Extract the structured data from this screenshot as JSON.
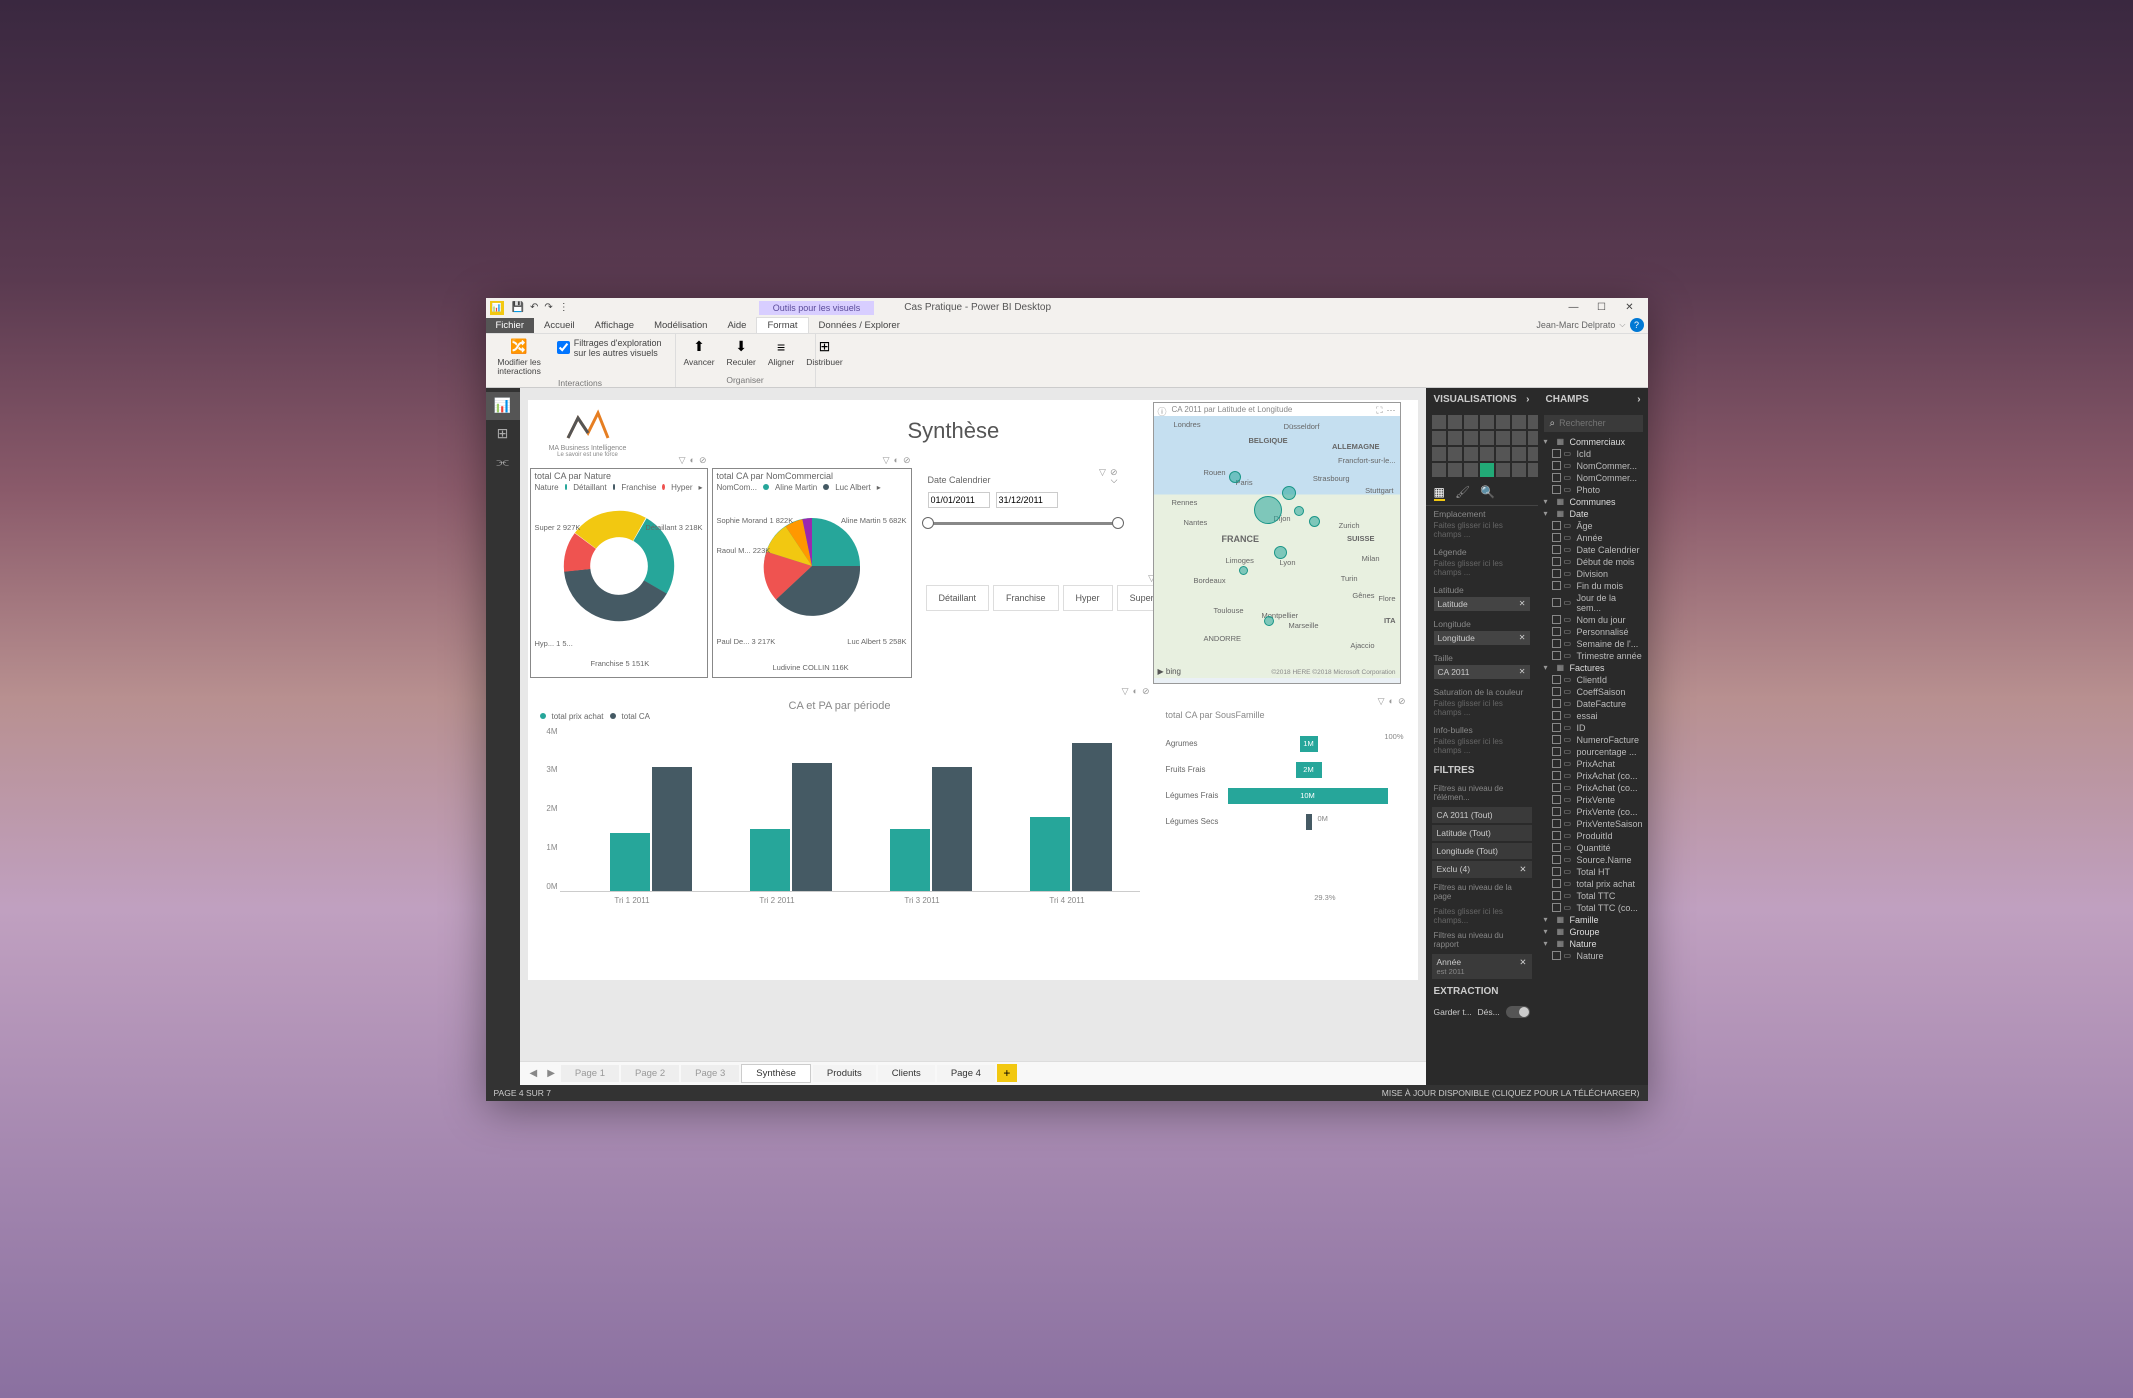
{
  "titlebar": {
    "tool_tab": "Outils pour les visuels",
    "app_title": "Cas Pratique - Power BI Desktop",
    "user": "Jean-Marc Delprato"
  },
  "ribbon_tabs": [
    "Fichier",
    "Accueil",
    "Affichage",
    "Modélisation",
    "Aide",
    "Format",
    "Données / Explorer"
  ],
  "ribbon": {
    "interactions_checkbox": "Filtrages d'exploration sur les autres visuels",
    "btn_modify": "Modifier les\ninteractions",
    "group_interactions": "Interactions",
    "btn_forward": "Avancer",
    "btn_backward": "Reculer",
    "btn_align": "Aligner",
    "btn_distribute": "Distribuer",
    "group_organize": "Organiser"
  },
  "viz_panel": {
    "title": "VISUALISATIONS",
    "well_emplacement": "Emplacement",
    "well_drag": "Faites glisser ici les champs ...",
    "well_legende": "Légende",
    "well_latitude": "Latitude",
    "well_longitude": "Longitude",
    "well_taille": "Taille",
    "well_ca2011": "CA 2011",
    "well_saturation": "Saturation de la couleur",
    "well_infobulle": "Info-bulles",
    "filters_title": "FILTRES",
    "filter_element": "Filtres au niveau de l'élémen...",
    "filter_ca": "CA 2011  (Tout)",
    "filter_lat": "Latitude  (Tout)",
    "filter_lon": "Longitude  (Tout)",
    "filter_exclu": "Exclu (4)",
    "filter_page": "Filtres au niveau de la page",
    "filter_drag": "Faites glisser ici les champs...",
    "filter_report": "Filtres au niveau du rapport",
    "filter_annee": "Année",
    "filter_annee_val": "est 2011",
    "extraction_title": "EXTRACTION",
    "extraction_keep": "Garder t...",
    "extraction_off": "Dés..."
  },
  "champs_panel": {
    "title": "CHAMPS",
    "search_ph": "Rechercher",
    "tables": [
      {
        "name": "Commerciaux",
        "cols": [
          "IcId",
          "NomCommer...",
          "NomCommer...",
          "Photo"
        ]
      },
      {
        "name": "Communes",
        "cols": []
      },
      {
        "name": "Date",
        "cols": [
          "Âge",
          "Année",
          "Date Calendrier",
          "Début de mois",
          "Division",
          "Fin du mois",
          "Jour de la sem...",
          "Nom du jour",
          "Personnalisé",
          "Semaine de l'...",
          "Trimestre année"
        ]
      },
      {
        "name": "Factures",
        "cols": [
          "ClientId",
          "CoeffSaison",
          "DateFacture",
          "essai",
          "ID",
          "NumeroFacture",
          "pourcentage ...",
          "PrixAchat",
          "PrixAchat (co...",
          "PrixAchat (co...",
          "PrixVente",
          "PrixVente (co...",
          "PrixVenteSaison",
          "ProduitId",
          "Quantité",
          "Source.Name",
          "Total HT",
          "total prix achat",
          "Total TTC",
          "Total TTC (co..."
        ]
      },
      {
        "name": "Famille",
        "cols": []
      },
      {
        "name": "Groupe",
        "cols": []
      },
      {
        "name": "Nature",
        "cols": [
          "Nature"
        ]
      }
    ]
  },
  "pages": {
    "list": [
      "Page 1",
      "Page 2",
      "Page 3",
      "Synthèse",
      "Produits",
      "Clients",
      "Page 4"
    ],
    "active": "Synthèse"
  },
  "status": {
    "left": "PAGE 4 SUR 7",
    "right": "MISE À JOUR DISPONIBLE (CLIQUEZ POUR LA TÉLÉCHARGER)"
  },
  "report": {
    "logo_text": "MA Business Intelligence",
    "logo_sub": "Le savoir est une force",
    "synth_title": "Synthèse",
    "donut": {
      "title": "total CA par Nature",
      "legend_label": "Nature",
      "items": [
        "Détaillant",
        "Franchise",
        "Hyper"
      ],
      "labels": {
        "super": "Super 2 927K",
        "detaillant": "Détaillant\n3 218K",
        "hyper": "Hyp...\n1 5...",
        "franchise": "Franchise\n5 151K"
      }
    },
    "pie": {
      "title": "total CA par NomCommercial",
      "legend_label": "NomCom...",
      "legend": [
        "Aline Martin",
        "Luc Albert"
      ],
      "labels": {
        "sophie": "Sophie Morand\n1 822K",
        "aline": "Aline Martin\n5 682K",
        "raoul": "Raoul M...\n223K",
        "paul": "Paul De...\n3 217K",
        "ludivine": "Ludivine COLLIN\n116K",
        "luc": "Luc Albert\n5 258K"
      }
    },
    "date_slicer": {
      "label": "Date Calendrier",
      "from": "01/01/2011",
      "to": "31/12/2011"
    },
    "buttons": [
      "Détaillant",
      "Franchise",
      "Hyper",
      "Super"
    ],
    "map": {
      "title": "CA 2011 par Latitude et Longitude",
      "cities": [
        "Londres",
        "Düsseldorf",
        "ALLEMAGNE",
        "BELGIQUE",
        "Francfort-sur-le...",
        "Rouen",
        "Paris",
        "Strasbourg",
        "Stuttgart",
        "Rennes",
        "Nantes",
        "Dijon",
        "Zurich",
        "FRANCE",
        "SUISSE",
        "Limoges",
        "Lyon",
        "Milan",
        "Bordeaux",
        "Turin",
        "Gênes",
        "Flore",
        "Toulouse",
        "Montpellier",
        "Marseille",
        "ITA",
        "ANDORRE",
        "Ajaccio"
      ],
      "bing": "bing",
      "copyright": "©2018 HERE ©2018 Microsoft Corporation"
    },
    "bar_chart": {
      "title": "CA et PA par période",
      "legend": [
        "total prix achat",
        "total CA"
      ],
      "y_ticks": [
        "4M",
        "3M",
        "2M",
        "1M",
        "0M"
      ],
      "categories": [
        "Tri 1 2011",
        "Tri 2 2011",
        "Tri 3 2011",
        "Tri 4 2011"
      ]
    },
    "hbar_chart": {
      "title": "total CA par SousFamille",
      "pct100": "100%",
      "rows": [
        {
          "label": "Agrumes",
          "value": "1M"
        },
        {
          "label": "Fruits Frais",
          "value": "2M"
        },
        {
          "label": "Légumes Frais",
          "value": "10M"
        },
        {
          "label": "Légumes Secs",
          "value": "0M"
        }
      ],
      "pct29": "29.3%"
    }
  },
  "chart_data": [
    {
      "type": "bar",
      "title": "CA et PA par période",
      "categories": [
        "Tri 1 2011",
        "Tri 2 2011",
        "Tri 3 2011",
        "Tri 4 2011"
      ],
      "series": [
        {
          "name": "total prix achat",
          "values": [
            1400000,
            1500000,
            1500000,
            1800000
          ]
        },
        {
          "name": "total CA",
          "values": [
            3000000,
            3100000,
            3000000,
            3600000
          ]
        }
      ],
      "ylim": [
        0,
        4000000
      ],
      "ylabel": "",
      "xlabel": ""
    },
    {
      "type": "bar",
      "title": "total CA par SousFamille",
      "orientation": "horizontal",
      "categories": [
        "Agrumes",
        "Fruits Frais",
        "Légumes Frais",
        "Légumes Secs"
      ],
      "values": [
        1000000,
        2000000,
        10000000,
        100000
      ]
    },
    {
      "type": "pie",
      "title": "total CA par Nature",
      "hole": 0.55,
      "categories": [
        "Détaillant",
        "Franchise",
        "Hyper",
        "Super"
      ],
      "values": [
        3218000,
        5151000,
        1500000,
        2927000
      ]
    },
    {
      "type": "pie",
      "title": "total CA par NomCommercial",
      "categories": [
        "Aline Martin",
        "Luc Albert",
        "Paul De...",
        "Sophie Morand",
        "Raoul M...",
        "Ludivine COLLIN"
      ],
      "values": [
        5682000,
        5258000,
        3217000,
        1822000,
        223000,
        116000
      ]
    }
  ]
}
